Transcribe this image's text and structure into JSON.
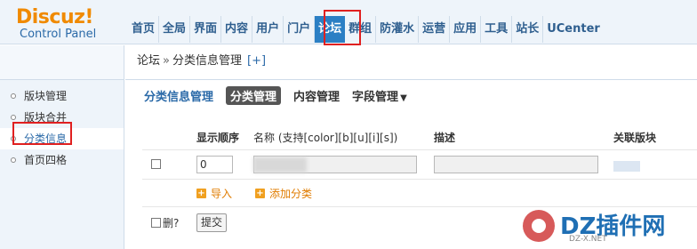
{
  "logo": {
    "main": "Discuz!",
    "sub": "Control Panel"
  },
  "nav": {
    "items": [
      {
        "label": "首页"
      },
      {
        "label": "全局"
      },
      {
        "label": "界面"
      },
      {
        "label": "内容"
      },
      {
        "label": "用户"
      },
      {
        "label": "门户"
      },
      {
        "label": "论坛",
        "active": true
      },
      {
        "label": "群组"
      },
      {
        "label": "防灌水"
      },
      {
        "label": "运营"
      },
      {
        "label": "应用"
      },
      {
        "label": "工具"
      },
      {
        "label": "站长"
      },
      {
        "label": "UCenter"
      }
    ]
  },
  "sidebar": {
    "items": [
      {
        "label": "版块管理"
      },
      {
        "label": "版块合并"
      },
      {
        "label": "分类信息",
        "active": true
      },
      {
        "label": "首页四格"
      }
    ]
  },
  "breadcrumb": {
    "root": "论坛",
    "separator": "»",
    "current": "分类信息管理",
    "add": "[+]"
  },
  "subtabs": {
    "heading": "分类信息管理",
    "tabs": [
      {
        "label": "分类管理",
        "active": true
      },
      {
        "label": "内容管理"
      },
      {
        "label": "字段管理",
        "dropdown": true
      }
    ],
    "caret": "▼"
  },
  "table": {
    "headers": {
      "order": "显示顺序",
      "name": "名称 (支持[color][b][u][i][s])",
      "desc": "描述",
      "forums": "关联版块"
    },
    "row": {
      "order_value": "0",
      "name_value": "",
      "desc_value": ""
    },
    "import_label": "导入",
    "add_label": "添加分类"
  },
  "footer": {
    "delete_label": "删?",
    "submit_label": "提交"
  },
  "watermark": {
    "title": "DZ插件网",
    "sub": "DZ-X.NET"
  },
  "colors": {
    "accent": "#2b7fc4",
    "highlight_frame": "#e02020",
    "link_orange": "#e07c00"
  }
}
